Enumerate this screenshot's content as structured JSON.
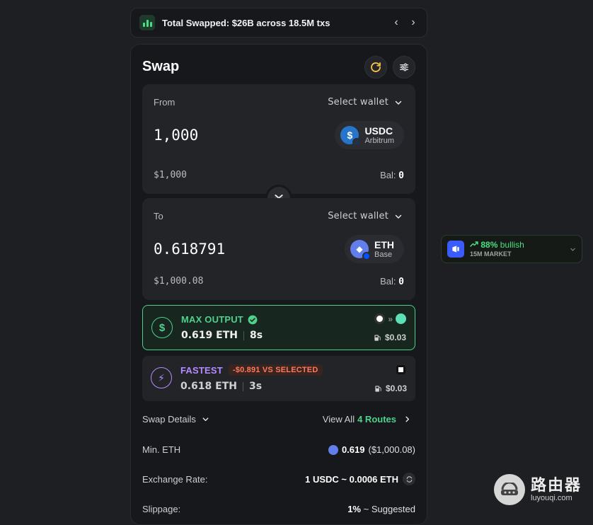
{
  "banner": {
    "text": "Total Swapped: $26B across 18.5M txs",
    "prev": "‹",
    "next": "›"
  },
  "swap": {
    "title": "Swap",
    "from": {
      "label": "From",
      "select_wallet": "Select wallet",
      "amount": "1,000",
      "usd": "$1,000",
      "bal_label": "Bal:",
      "bal_value": "0",
      "token": {
        "symbol": "USDC",
        "network": "Arbitrum",
        "glyph": "$"
      }
    },
    "to": {
      "label": "To",
      "select_wallet": "Select wallet",
      "amount": "0.618791",
      "usd": "$1,000.08",
      "bal_label": "Bal:",
      "bal_value": "0",
      "token": {
        "symbol": "ETH",
        "network": "Base",
        "glyph": "◆"
      }
    }
  },
  "routes": [
    {
      "title": "MAX OUTPUT",
      "amount": "0.619 ETH",
      "time": "8s",
      "gas": "$0.03",
      "icon": "$",
      "selected": true
    },
    {
      "title": "FASTEST",
      "badge": "-$0.891 VS SELECTED",
      "amount": "0.618 ETH",
      "time": "3s",
      "gas": "$0.03",
      "icon": "⚡",
      "selected": false
    }
  ],
  "details": {
    "label": "Swap Details",
    "view_all": "View All",
    "routes_count": "4 Routes",
    "min_label": "Min. ETH",
    "min_value": "0.619",
    "min_usd": "($1,000.08)",
    "rate_label": "Exchange Rate:",
    "rate_value": "1 USDC ~ 0.0006 ETH",
    "slippage_label": "Slippage:",
    "slippage_value": "1%",
    "slippage_note": "~ Suggested"
  },
  "market": {
    "percent": "88%",
    "sentiment": "bullish",
    "label": "15M MARKET"
  },
  "watermark": {
    "cn": "路由器",
    "url": "luyouqi.com"
  },
  "colors": {
    "accent_green": "#4fd18b",
    "purple": "#b48cff",
    "usdc": "#2775ca",
    "eth": "#627eea"
  }
}
